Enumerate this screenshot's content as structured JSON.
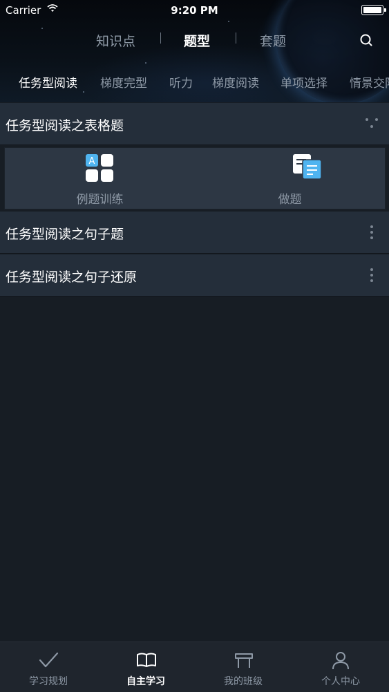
{
  "status_bar": {
    "carrier": "Carrier",
    "time": "9:20 PM"
  },
  "top_tabs": [
    {
      "label": "知识点",
      "active": false
    },
    {
      "label": "题型",
      "active": true
    },
    {
      "label": "套题",
      "active": false
    }
  ],
  "sub_tabs": [
    {
      "label": "任务型阅读",
      "active": true
    },
    {
      "label": "梯度完型",
      "active": false
    },
    {
      "label": "听力",
      "active": false
    },
    {
      "label": "梯度阅读",
      "active": false
    },
    {
      "label": "单项选择",
      "active": false
    },
    {
      "label": "情景交际",
      "active": false
    }
  ],
  "list": {
    "items": [
      {
        "label": "任务型阅读之表格题",
        "expanded": true
      },
      {
        "label": "任务型阅读之句子题",
        "expanded": false
      },
      {
        "label": "任务型阅读之句子还原",
        "expanded": false
      }
    ],
    "expanded_actions": [
      {
        "label": "例题训练",
        "icon": "grid-a-icon"
      },
      {
        "label": "做题",
        "icon": "document-icon"
      }
    ]
  },
  "icon_letters": {
    "grid_tile": "A"
  },
  "bottom_nav": [
    {
      "label": "学习规划",
      "icon": "check-icon",
      "active": false
    },
    {
      "label": "自主学习",
      "icon": "book-icon",
      "active": true
    },
    {
      "label": "我的班级",
      "icon": "desk-icon",
      "active": false
    },
    {
      "label": "个人中心",
      "icon": "person-icon",
      "active": false
    }
  ],
  "colors": {
    "background": "#171d24",
    "row": "#242e3a",
    "accent_blue": "#4fb4f0",
    "inactive_text": "#8e99a6"
  }
}
